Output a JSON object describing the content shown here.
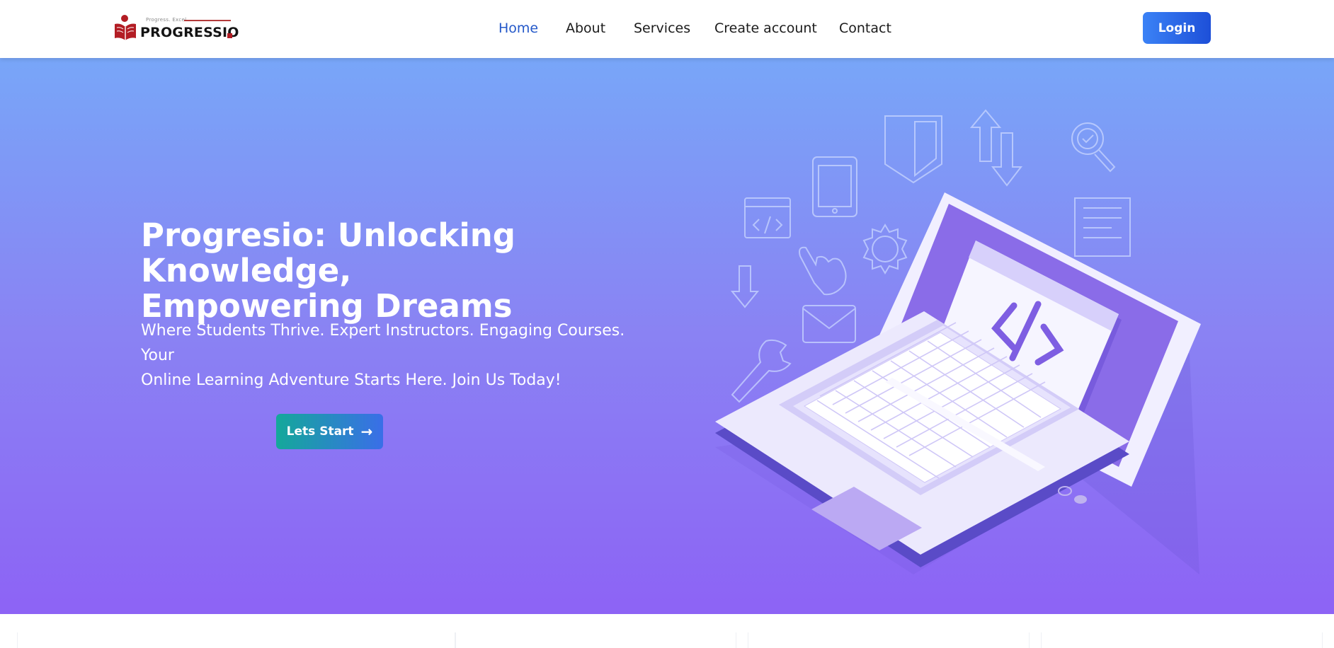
{
  "brand": {
    "tagline": "Progress. Excel.",
    "name": "PROGRESSIO"
  },
  "nav": {
    "items": [
      {
        "label": "Home",
        "active": true
      },
      {
        "label": "About",
        "active": false
      },
      {
        "label": "Services",
        "active": false
      },
      {
        "label": "Create account",
        "active": false
      },
      {
        "label": "Contact",
        "active": false
      }
    ],
    "login_label": "Login"
  },
  "hero": {
    "title_line1": "Progresio: Unlocking Knowledge,",
    "title_line2": "Empowering Dreams",
    "subtitle_line1": "Where Students Thrive. Expert Instructors. Engaging Courses. Your",
    "subtitle_line2": "Online Learning Adventure Starts Here. Join Us Today!",
    "cta_label": "Lets Start",
    "illustration_icons": [
      "code-window-icon",
      "tablet-icon",
      "shield-icon",
      "updown-arrows-icon",
      "magnifier-check-icon",
      "document-icon",
      "pointer-hand-icon",
      "gear-icon",
      "down-arrow-icon",
      "mail-icon",
      "wrench-icon",
      "laptop-icon"
    ]
  },
  "colors": {
    "accent": "#2458c9",
    "login_start": "#3b82f6",
    "login_end": "#1d4fd8",
    "hero_top": "#78a6f8",
    "hero_bottom": "#8d63f5",
    "cta_start": "#14a89a",
    "cta_end": "#3a6ee8",
    "brand_red": "#b31d24"
  }
}
